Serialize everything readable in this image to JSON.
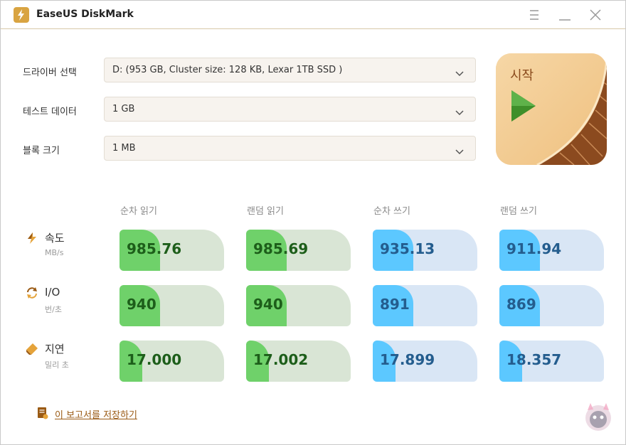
{
  "window": {
    "title": "EaseUS DiskMark"
  },
  "settings": {
    "drive": {
      "label": "드라이버 선택",
      "value": "D: (953 GB, Cluster size: 128 KB, Lexar 1TB SSD )"
    },
    "test_data": {
      "label": "테스트 데이터",
      "value": "1 GB"
    },
    "block_size": {
      "label": "블록 크기",
      "value": "1 MB"
    }
  },
  "start_button": {
    "label": "시작"
  },
  "columns": [
    "순차 읽기",
    "랜덤 읽기",
    "순차 쓰기",
    "랜덤 쓰기"
  ],
  "rows": [
    {
      "title": "속도",
      "unit": "MB/s",
      "icon": "lightning-icon",
      "values": [
        {
          "value": "985.76",
          "fill": 0.39
        },
        {
          "value": "985.69",
          "fill": 0.39
        },
        {
          "value": "935.13",
          "fill": 0.39
        },
        {
          "value": "911.94",
          "fill": 0.39
        }
      ]
    },
    {
      "title": "I/O",
      "unit": "번/초",
      "icon": "refresh-icon",
      "values": [
        {
          "value": "940",
          "fill": 0.39
        },
        {
          "value": "940",
          "fill": 0.39
        },
        {
          "value": "891",
          "fill": 0.39
        },
        {
          "value": "869",
          "fill": 0.39
        }
      ]
    },
    {
      "title": "지연",
      "unit": "밀리 초",
      "icon": "latency-icon",
      "values": [
        {
          "value": "17.000",
          "fill": 0.22
        },
        {
          "value": "17.002",
          "fill": 0.22
        },
        {
          "value": "17.899",
          "fill": 0.22
        },
        {
          "value": "18.357",
          "fill": 0.22
        }
      ]
    }
  ],
  "footer": {
    "report_link": "이 보고서를 저장하기"
  },
  "colors": {
    "read_fill": "#6fd16a",
    "write_fill": "#5cc8ff",
    "accent": "#9a5a14"
  }
}
